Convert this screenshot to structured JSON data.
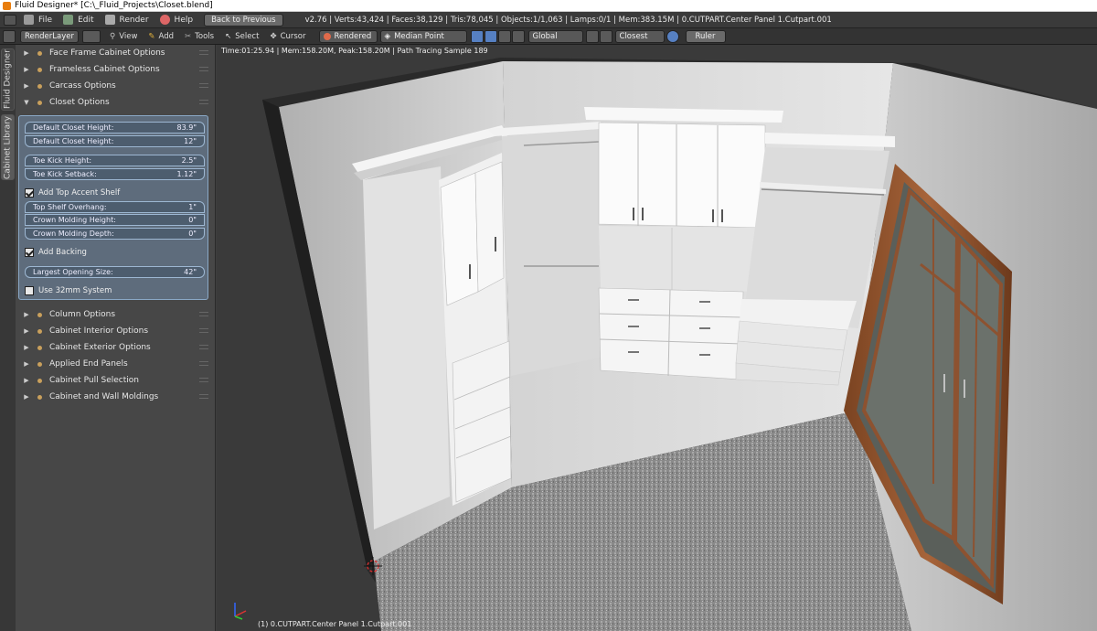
{
  "window": {
    "title": "Fluid Designer* [C:\\_Fluid_Projects\\Closet.blend]"
  },
  "menubar": {
    "items": [
      "File",
      "Edit",
      "Render",
      "Help"
    ],
    "back_button": "Back to Previous",
    "stats": "v2.76 | Verts:43,424 | Faces:38,129 | Tris:78,045 | Objects:1/1,063 | Lamps:0/1 | Mem:383.15M | 0.CUTPART.Center Panel 1.Cutpart.001"
  },
  "toolbar": {
    "render_layer": "RenderLayer",
    "view": "View",
    "add": "Add",
    "tools": "Tools",
    "select": "Select",
    "cursor": "Cursor",
    "shading": "Rendered",
    "pivot": "Median Point",
    "orientation": "Global",
    "snap": "Closest",
    "ruler": "Ruler"
  },
  "sidetabs": {
    "fluid_designer": "Fluid Designer",
    "cabinet_library": "Cabinet Library"
  },
  "panel": {
    "sections_top": [
      "Face Frame Cabinet Options",
      "Frameless Cabinet Options",
      "Carcass Options",
      "Closet Options"
    ],
    "closet_fields": [
      {
        "label": "Default Closet Height:",
        "value": "83.9\""
      },
      {
        "label": "Default Closet Height:",
        "value": "12\""
      },
      {
        "label": "Toe Kick Height:",
        "value": "2.5\""
      },
      {
        "label": "Toe Kick Setback:",
        "value": "1.12\""
      },
      {
        "label": "Top Shelf Overhang:",
        "value": "1\""
      },
      {
        "label": "Crown Molding Height:",
        "value": "0\""
      },
      {
        "label": "Crown Molding Depth:",
        "value": "0\""
      },
      {
        "label": "Largest Opening Size:",
        "value": "42\""
      }
    ],
    "checks": {
      "accent": "Add Top Accent Shelf",
      "backing": "Add Backing",
      "metric": "Use 32mm System"
    },
    "sections_bottom": [
      "Column Options",
      "Cabinet Interior Options",
      "Cabinet Exterior Options",
      "Applied End Panels",
      "Cabinet Pull Selection",
      "Cabinet and Wall Moldings"
    ]
  },
  "viewport": {
    "info": "Time:01:25.94 | Mem:158.20M, Peak:158.20M | Path Tracing Sample 189",
    "object": "(1) 0.CUTPART.Center Panel 1.Cutpart.001"
  }
}
